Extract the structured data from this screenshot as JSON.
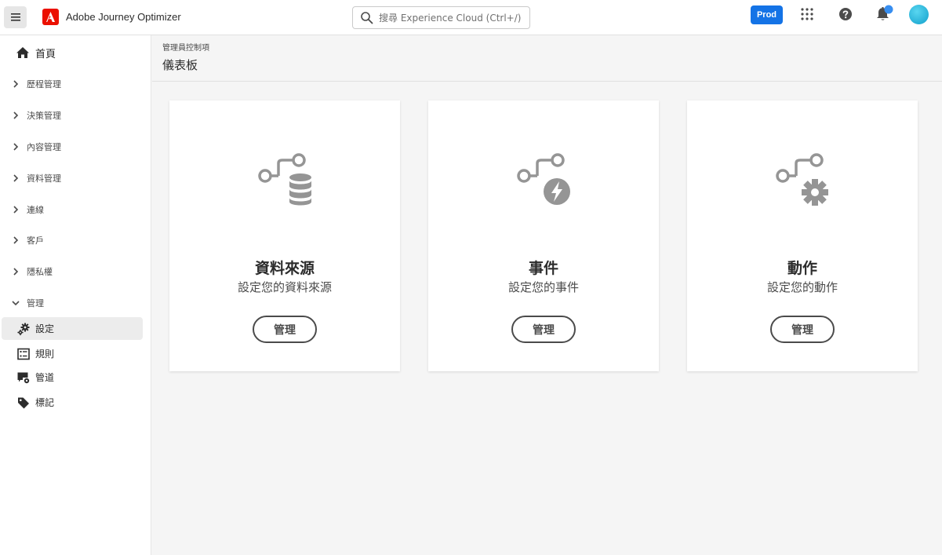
{
  "topbar": {
    "app_name": "Adobe Journey Optimizer",
    "search_placeholder": "搜尋 Experience Cloud (Ctrl+/)",
    "environment_label": "Prod"
  },
  "sidebar": {
    "home_label": "首頁",
    "sections": [
      {
        "label": "歷程管理",
        "expanded": false
      },
      {
        "label": "決策管理",
        "expanded": false
      },
      {
        "label": "內容管理",
        "expanded": false
      },
      {
        "label": "資料管理",
        "expanded": false
      },
      {
        "label": "連線",
        "expanded": false
      },
      {
        "label": "客戶",
        "expanded": false
      },
      {
        "label": "隱私權",
        "expanded": false
      },
      {
        "label": "管理",
        "expanded": true
      }
    ],
    "admin_items": [
      {
        "label": "設定",
        "icon": "gears-icon",
        "selected": true
      },
      {
        "label": "規則",
        "icon": "rules-icon",
        "selected": false
      },
      {
        "label": "管道",
        "icon": "channel-icon",
        "selected": false
      },
      {
        "label": "標記",
        "icon": "tag-icon",
        "selected": false
      }
    ]
  },
  "main": {
    "breadcrumb": "管理員控制項",
    "title": "儀表板",
    "cards": [
      {
        "title": "資料來源",
        "subtitle": "設定您的資料來源",
        "button": "管理",
        "icon": "data-source-icon"
      },
      {
        "title": "事件",
        "subtitle": "設定您的事件",
        "button": "管理",
        "icon": "event-icon"
      },
      {
        "title": "動作",
        "subtitle": "設定您的動作",
        "button": "管理",
        "icon": "action-icon"
      }
    ]
  },
  "colors": {
    "accent": "#1473e6",
    "brand": "#eb1000",
    "icon_gray": "#959595",
    "notification_dot": "#378ef0"
  }
}
